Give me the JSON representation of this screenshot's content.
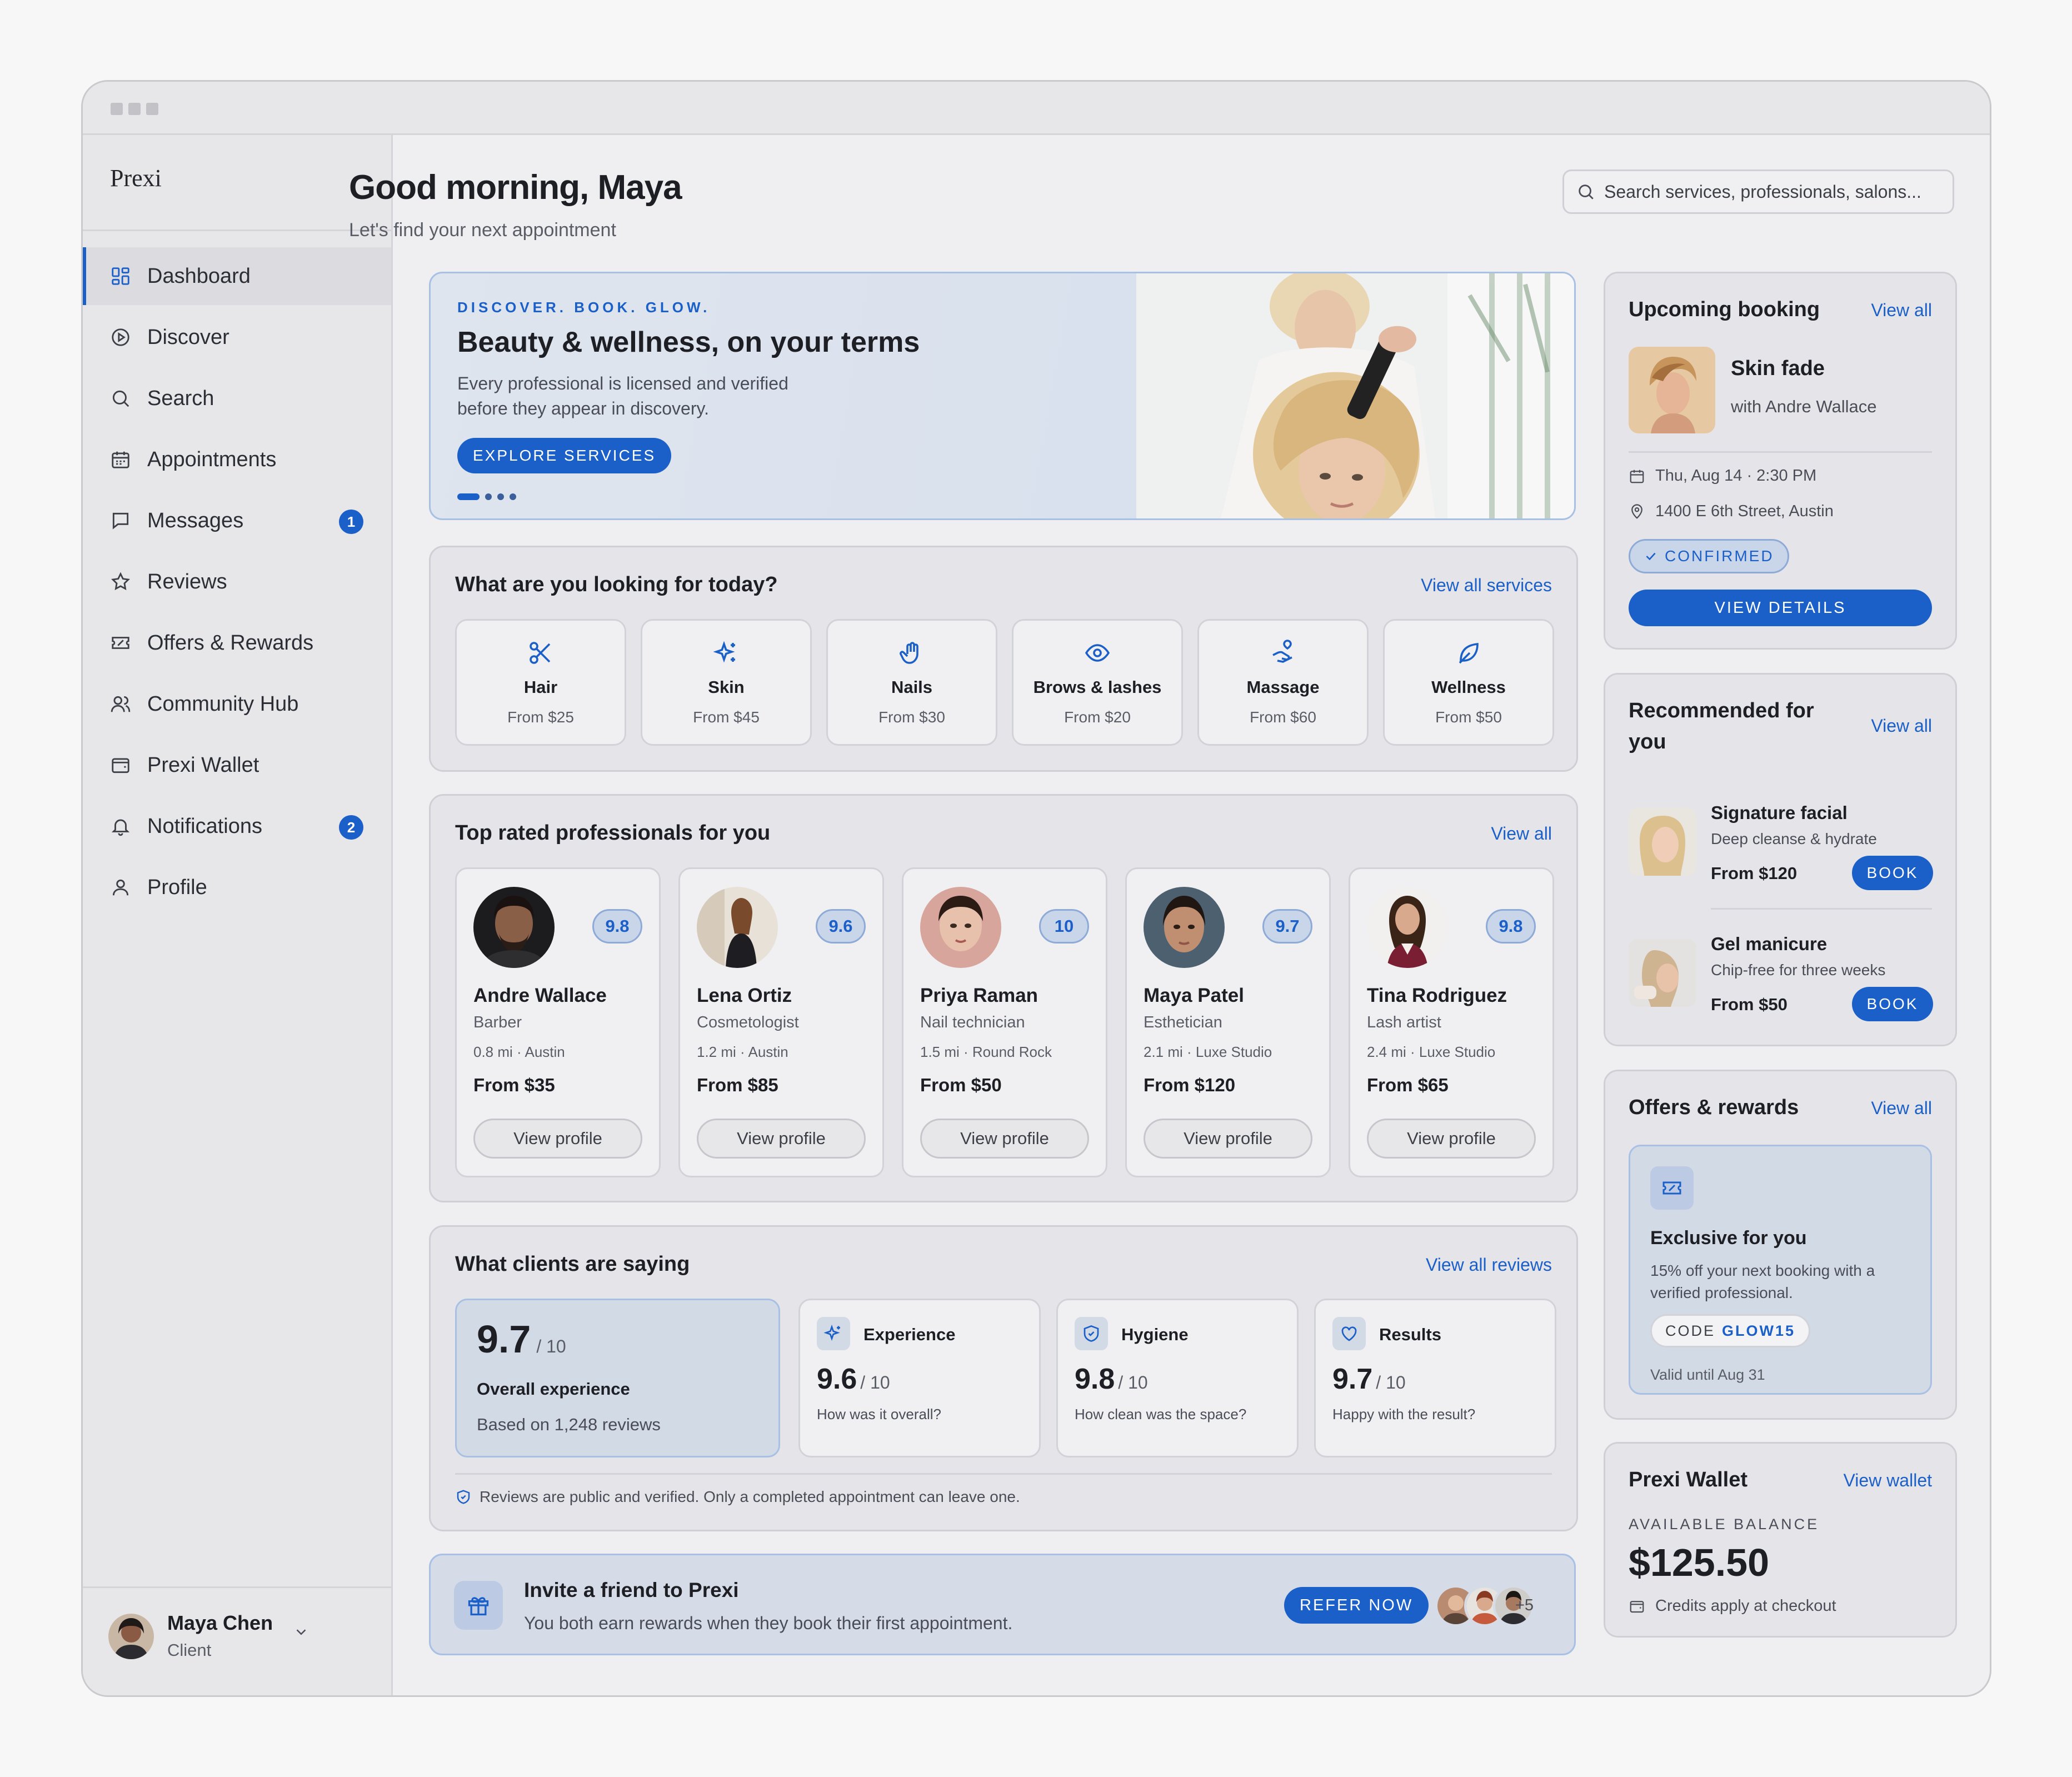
{
  "app": {
    "brand": "Prexi"
  },
  "sidebar": {
    "items": [
      {
        "label": "Dashboard",
        "icon": "grid-icon",
        "active": true
      },
      {
        "label": "Discover",
        "icon": "compass-icon"
      },
      {
        "label": "Search",
        "icon": "search-icon"
      },
      {
        "label": "Appointments",
        "icon": "calendar-icon"
      },
      {
        "label": "Messages",
        "icon": "message-icon",
        "badge": "1"
      },
      {
        "label": "Reviews",
        "icon": "star-icon"
      },
      {
        "label": "Offers & Rewards",
        "icon": "ticket-icon"
      },
      {
        "label": "Community Hub",
        "icon": "users-icon"
      },
      {
        "label": "Prexi Wallet",
        "icon": "wallet-icon"
      },
      {
        "label": "Notifications",
        "icon": "bell-icon",
        "badge": "2"
      },
      {
        "label": "Profile",
        "icon": "user-icon"
      }
    ],
    "user": {
      "name": "Maya Chen",
      "role": "Client"
    }
  },
  "header": {
    "greeting": "Good morning, Maya",
    "subtitle": "Let's find your next appointment",
    "search_placeholder": "Search services, professionals, salons..."
  },
  "hero": {
    "eyebrow": "DISCOVER. BOOK. GLOW.",
    "title": "Beauty & wellness, on your terms",
    "description": "Every professional is licensed and verified before they appear in discovery.",
    "button": "EXPLORE SERVICES"
  },
  "services": {
    "title": "What are you looking for today?",
    "link": "View all services",
    "items": [
      {
        "name": "Hair",
        "price": "From $25",
        "icon": "scissors-icon"
      },
      {
        "name": "Skin",
        "price": "From $45",
        "icon": "sparkles-icon"
      },
      {
        "name": "Nails",
        "price": "From $30",
        "icon": "hand-icon"
      },
      {
        "name": "Brows & lashes",
        "price": "From $20",
        "icon": "eye-icon"
      },
      {
        "name": "Massage",
        "price": "From $60",
        "icon": "massage-hand-icon"
      },
      {
        "name": "Wellness",
        "price": "From $50",
        "icon": "leaf-icon"
      }
    ]
  },
  "pros": {
    "title": "Top rated professionals for you",
    "link": "View all",
    "button": "View profile",
    "items": [
      {
        "name": "Andre Wallace",
        "role": "Barber",
        "loc": "0.8 mi · Austin",
        "price": "From $35",
        "score": "9.8"
      },
      {
        "name": "Lena Ortiz",
        "role": "Cosmetologist",
        "loc": "1.2 mi · Austin",
        "price": "From $85",
        "score": "9.6"
      },
      {
        "name": "Priya Raman",
        "role": "Nail technician",
        "loc": "1.5 mi · Round Rock",
        "price": "From $50",
        "score": "10"
      },
      {
        "name": "Maya Patel",
        "role": "Esthetician",
        "loc": "2.1 mi · Luxe Studio",
        "price": "From $120",
        "score": "9.7"
      },
      {
        "name": "Tina Rodriguez",
        "role": "Lash artist",
        "loc": "2.4 mi · Luxe Studio",
        "price": "From $65",
        "score": "9.8"
      }
    ]
  },
  "reviews": {
    "title": "What clients are saying",
    "link": "View all reviews",
    "overall": {
      "value": "9.7",
      "out_of": "/ 10",
      "label": "Overall experience",
      "count": "Based on 1,248 reviews"
    },
    "items": [
      {
        "name": "Experience",
        "value": "9.6",
        "out_of": "/ 10",
        "question": "How was it overall?",
        "icon": "sparkles-icon"
      },
      {
        "name": "Hygiene",
        "value": "9.8",
        "out_of": "/ 10",
        "question": "How clean was the space?",
        "icon": "shield-icon"
      },
      {
        "name": "Results",
        "value": "9.7",
        "out_of": "/ 10",
        "question": "Happy with the result?",
        "icon": "heart-icon"
      }
    ],
    "note": "Reviews are public and verified. Only a completed appointment can leave one."
  },
  "invite": {
    "title": "Invite a friend to Prexi",
    "subtitle": "You both earn rewards when they book their first appointment.",
    "button": "REFER NOW",
    "more": "+5"
  },
  "upcoming": {
    "title": "Upcoming booking",
    "link": "View all",
    "service": "Skin fade",
    "with": "with Andre Wallace",
    "date": "Thu, Aug 14 · 2:30 PM",
    "address": "1400 E 6th Street, Austin",
    "status": "CONFIRMED",
    "button": "VIEW DETAILS"
  },
  "recommended": {
    "title_line1": "Recommended for",
    "title_line2": "you",
    "link": "View all",
    "button": "BOOK",
    "items": [
      {
        "name": "Signature facial",
        "desc": "Deep cleanse & hydrate",
        "price": "From $120"
      },
      {
        "name": "Gel manicure",
        "desc": "Chip-free for three weeks",
        "price": "From $50"
      }
    ]
  },
  "offers": {
    "title": "Offers & rewards",
    "link": "View all",
    "card_title": "Exclusive for you",
    "card_desc": "15% off your next booking with a verified professional.",
    "code_label": "CODE",
    "code": "GLOW15",
    "valid": "Valid until Aug 31"
  },
  "wallet": {
    "title": "Prexi Wallet",
    "link": "View wallet",
    "label": "AVAILABLE BALANCE",
    "balance": "$125.50",
    "note": "Credits apply at checkout"
  },
  "colors": {
    "accent": "#1b5fc8",
    "background": "#efeff1",
    "card": "#e5e5e9",
    "highlight": "#d2dae6"
  }
}
